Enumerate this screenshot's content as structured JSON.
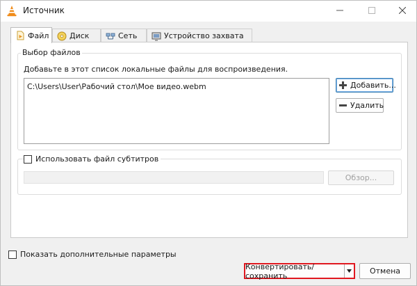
{
  "window": {
    "title": "Источник"
  },
  "tabs": [
    {
      "label": "Файл",
      "icon": "file-icon",
      "active": true
    },
    {
      "label": "Диск",
      "icon": "disc-icon",
      "active": false
    },
    {
      "label": "Сеть",
      "icon": "network-icon",
      "active": false
    },
    {
      "label": "Устройство захвата",
      "icon": "capture-device-icon",
      "active": false
    }
  ],
  "files": {
    "group_label": "Выбор файлов",
    "hint": "Добавьте в этот список локальные файлы для воспроизведения.",
    "items": [
      "C:\\Users\\User\\Рабочий стол\\Мое видео.webm"
    ],
    "add_label": "Добавить...",
    "remove_label": "Удалить"
  },
  "subtitles": {
    "checkbox_label": "Использовать файл субтитров",
    "checked": false,
    "path_value": "",
    "browse_label": "Обзор..."
  },
  "advanced": {
    "checkbox_label": "Показать дополнительные параметры",
    "checked": false
  },
  "footer": {
    "convert_label": "Конвертировать/сохранить",
    "cancel_label": "Отмена"
  },
  "colors": {
    "highlight": "#e0171f",
    "accent": "#3c7fb1",
    "vlc_orange": "#f08c1a"
  }
}
